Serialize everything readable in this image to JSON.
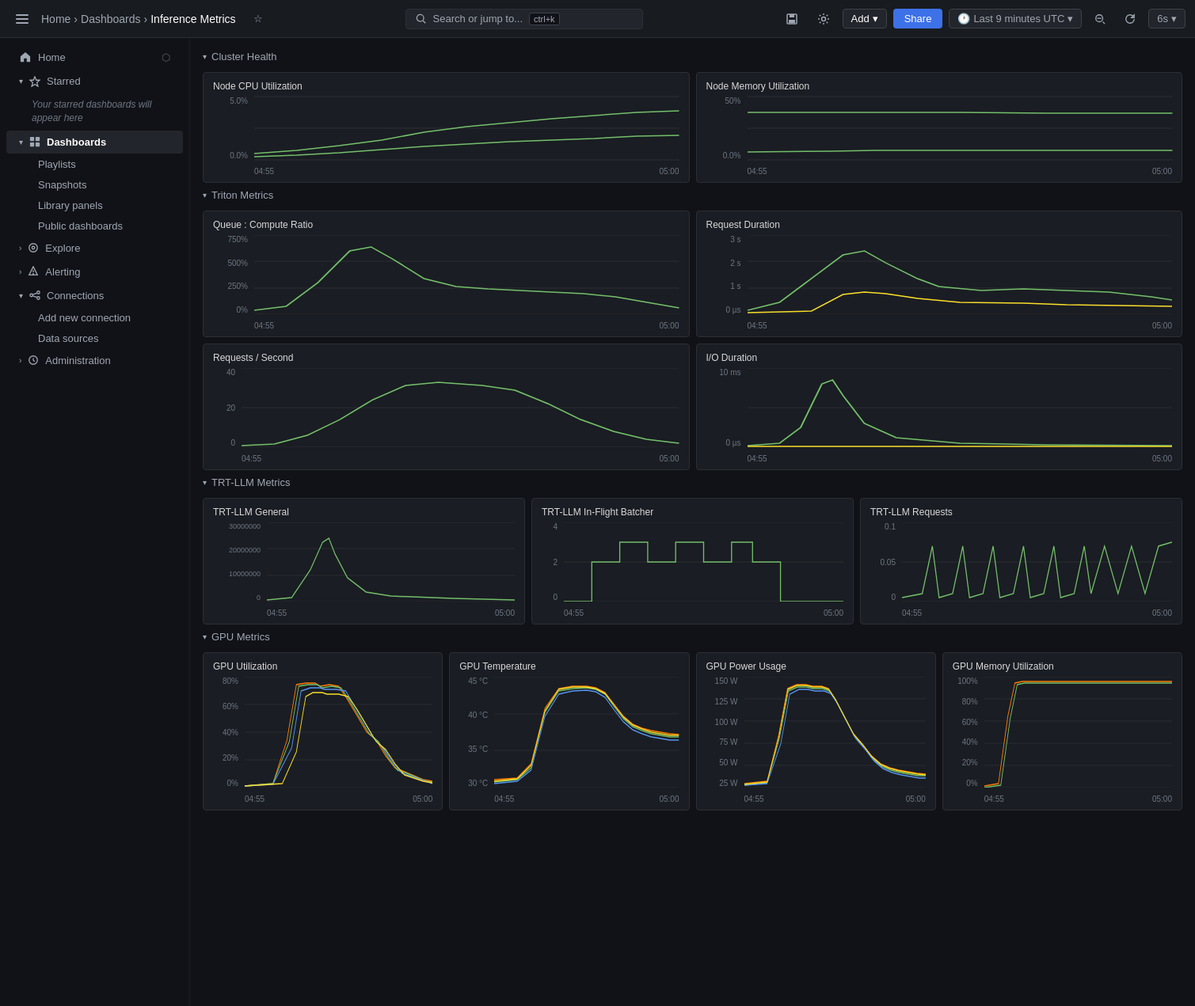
{
  "topbar": {
    "search_placeholder": "Search or jump to...",
    "shortcut": "ctrl+k",
    "breadcrumb": {
      "home": "Home",
      "dashboards": "Dashboards",
      "current": "Inference Metrics"
    },
    "add_label": "Add",
    "share_label": "Share",
    "time_range": "Last 9 minutes UTC",
    "refresh": "6s"
  },
  "sidebar": {
    "home_label": "Home",
    "starred_label": "Starred",
    "starred_note": "Your starred dashboards will appear here",
    "dashboards_label": "Dashboards",
    "playlists_label": "Playlists",
    "snapshots_label": "Snapshots",
    "library_panels_label": "Library panels",
    "public_dashboards_label": "Public dashboards",
    "explore_label": "Explore",
    "alerting_label": "Alerting",
    "connections_label": "Connections",
    "add_connection_label": "Add new connection",
    "data_sources_label": "Data sources",
    "administration_label": "Administration"
  },
  "sections": {
    "cluster_health": "Cluster Health",
    "triton_metrics": "Triton Metrics",
    "trt_llm_metrics": "TRT-LLM Metrics",
    "gpu_metrics": "GPU Metrics"
  },
  "panels": {
    "node_cpu": {
      "title": "Node CPU Utilization",
      "y_labels": [
        "5.0%",
        "0.0%"
      ],
      "x_labels": [
        "04:55",
        "05:00"
      ]
    },
    "node_memory": {
      "title": "Node Memory Utilization",
      "y_labels": [
        "50%",
        "0.0%"
      ],
      "x_labels": [
        "04:55",
        "05:00"
      ]
    },
    "queue_compute": {
      "title": "Queue : Compute Ratio",
      "y_labels": [
        "750%",
        "500%",
        "250%",
        "0%"
      ],
      "x_labels": [
        "04:55",
        "05:00"
      ]
    },
    "request_duration": {
      "title": "Request Duration",
      "y_labels": [
        "3 s",
        "2 s",
        "1 s",
        "0 µs"
      ],
      "x_labels": [
        "04:55",
        "05:00"
      ]
    },
    "requests_second": {
      "title": "Requests / Second",
      "y_labels": [
        "40",
        "20",
        "0"
      ],
      "x_labels": [
        "04:55",
        "05:00"
      ]
    },
    "io_duration": {
      "title": "I/O Duration",
      "y_labels": [
        "10 ms",
        "0 µs"
      ],
      "x_labels": [
        "04:55",
        "05:00"
      ]
    },
    "trt_general": {
      "title": "TRT-LLM General",
      "y_labels": [
        "30000000",
        "20000000",
        "10000000",
        "0"
      ],
      "x_labels": [
        "04:55",
        "05:00"
      ]
    },
    "trt_batcher": {
      "title": "TRT-LLM In-Flight Batcher",
      "y_labels": [
        "4",
        "2",
        "0"
      ],
      "x_labels": [
        "04:55",
        "05:00"
      ]
    },
    "trt_requests": {
      "title": "TRT-LLM Requests",
      "y_labels": [
        "0.1",
        "0.05",
        "0"
      ],
      "x_labels": [
        "04:55",
        "05:00"
      ]
    },
    "gpu_util": {
      "title": "GPU Utilization",
      "y_labels": [
        "80%",
        "60%",
        "40%",
        "20%",
        "0%"
      ],
      "x_labels": [
        "04:55",
        "05:00"
      ]
    },
    "gpu_temp": {
      "title": "GPU Temperature",
      "y_labels": [
        "45 °C",
        "40 °C",
        "35 °C",
        "30 °C"
      ],
      "x_labels": [
        "04:55",
        "05:00"
      ]
    },
    "gpu_power": {
      "title": "GPU Power Usage",
      "y_labels": [
        "150 W",
        "125 W",
        "100 W",
        "75 W",
        "50 W",
        "25 W"
      ],
      "x_labels": [
        "04:55",
        "05:00"
      ]
    },
    "gpu_memory": {
      "title": "GPU Memory Utilization",
      "y_labels": [
        "100%",
        "80%",
        "60%",
        "40%",
        "20%",
        "0%"
      ],
      "x_labels": [
        "04:55",
        "05:00"
      ]
    }
  }
}
